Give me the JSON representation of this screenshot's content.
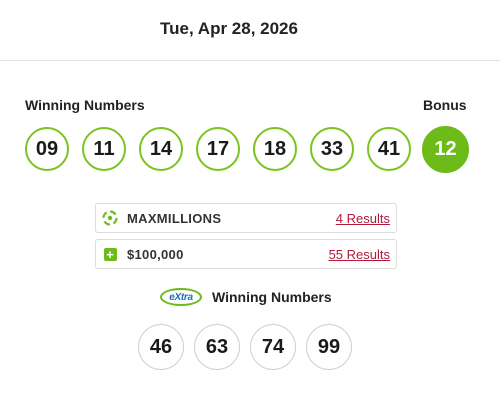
{
  "draw_date": "Tue, Apr 28, 2026",
  "winning_numbers_label": "Winning Numbers",
  "bonus_label": "Bonus",
  "numbers": [
    "09",
    "11",
    "14",
    "17",
    "18",
    "33",
    "41"
  ],
  "bonus": "12",
  "prizes": [
    {
      "name": "MAXMILLIONS",
      "link": "4 Results",
      "icon": "maxmillions-icon"
    },
    {
      "name": "$100,000",
      "link": "55 Results",
      "icon": "plus-icon"
    }
  ],
  "extra": {
    "logo_text": "eXtra",
    "label": "Winning Numbers",
    "numbers": [
      "46",
      "63",
      "74",
      "99"
    ]
  },
  "colors": {
    "accent_green": "#6cbb19",
    "link_red": "#b3193a"
  }
}
